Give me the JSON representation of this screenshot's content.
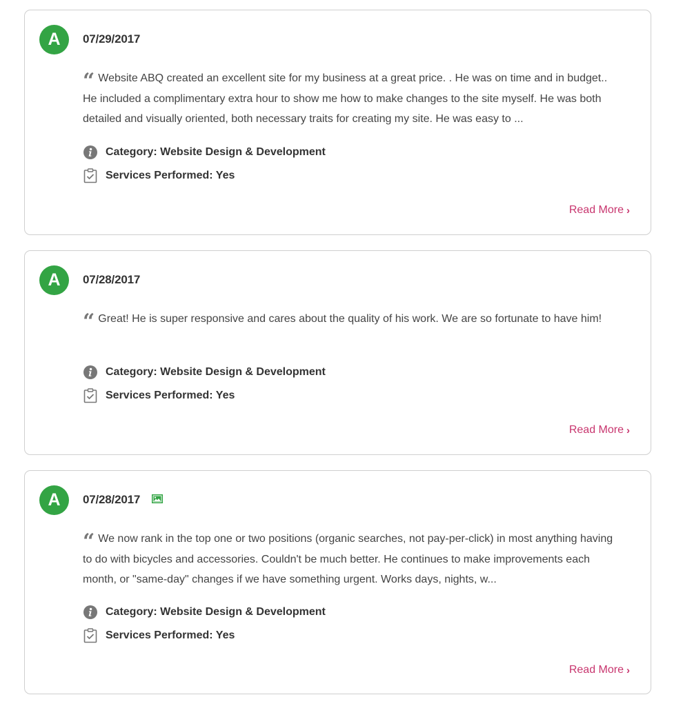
{
  "reviews": [
    {
      "avatar_letter": "A",
      "date": "07/29/2017",
      "has_photo": false,
      "text": "Website ABQ created an excellent site for my business at a great price. . He was on time and in budget.. He included a complimentary extra hour to show me how to make changes to the site myself. He was both detailed and visually oriented, both necessary traits for creating my site. He was easy to ...",
      "category_label": "Category: Website Design & Development",
      "services_label": "Services Performed: Yes",
      "read_more_label": "Read More"
    },
    {
      "avatar_letter": "A",
      "date": "07/28/2017",
      "has_photo": false,
      "text": "Great! He is super responsive and cares about the quality of his work. We are so fortunate to have him!",
      "category_label": "Category: Website Design & Development",
      "services_label": "Services Performed: Yes",
      "read_more_label": "Read More"
    },
    {
      "avatar_letter": "A",
      "date": "07/28/2017",
      "has_photo": true,
      "text": "We now rank in the top one or two positions (organic searches, not pay-per-click) in most anything having to do with bicycles and accessories. Couldn't be much better. He continues to make improvements each month, or \"same-day\" changes if we have something urgent. Works days, nights, w...",
      "category_label": "Category: Website Design & Development",
      "services_label": "Services Performed: Yes",
      "read_more_label": "Read More"
    }
  ],
  "icons": {
    "quote": "quote-icon",
    "category": "info-icon",
    "services": "clipboard-check-icon",
    "read_more": "chevron-right-icon",
    "photo": "image-icon"
  },
  "colors": {
    "avatar_bg": "#33a444",
    "link": "#c8356e",
    "card_border": "#cfcfcf",
    "photo_icon": "#33a444"
  }
}
